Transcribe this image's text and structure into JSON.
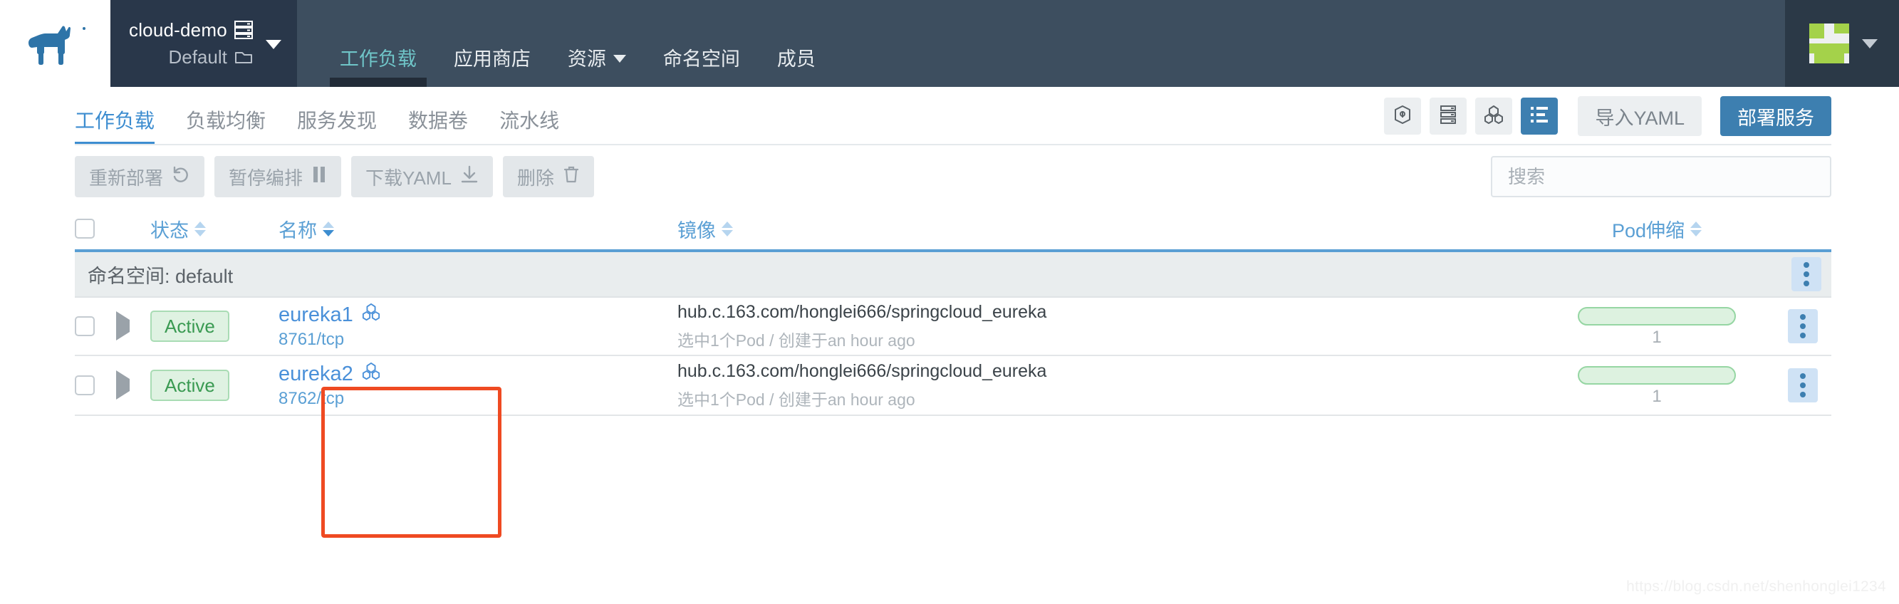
{
  "header": {
    "logo_name": "rancher-bull-logo",
    "project_selector": {
      "cluster": "cloud-demo",
      "cluster_icon": "server-stack-icon",
      "project": "Default",
      "project_icon": "folder-icon",
      "chevron_icon": "chevron-down-icon"
    },
    "nav_items": [
      {
        "label": "工作负载",
        "active": true,
        "has_caret": false
      },
      {
        "label": "应用商店",
        "active": false,
        "has_caret": false
      },
      {
        "label": "资源",
        "active": false,
        "has_caret": true
      },
      {
        "label": "命名空间",
        "active": false,
        "has_caret": false
      },
      {
        "label": "成员",
        "active": false,
        "has_caret": false
      }
    ],
    "user": {
      "avatar_name": "user-avatar-identicon",
      "chevron_icon": "chevron-down-icon"
    }
  },
  "tabs": [
    {
      "label": "工作负载",
      "active": true
    },
    {
      "label": "负载均衡",
      "active": false
    },
    {
      "label": "服务发现",
      "active": false
    },
    {
      "label": "数据卷",
      "active": false
    },
    {
      "label": "流水线",
      "active": false
    }
  ],
  "view_toggles": [
    {
      "icon": "pod-hexagon-icon",
      "selected": false
    },
    {
      "icon": "server-stack-icon",
      "selected": false
    },
    {
      "icon": "workload-cubes-icon",
      "selected": false
    },
    {
      "icon": "list-view-icon",
      "selected": true
    }
  ],
  "actions": {
    "import_yaml": "导入YAML",
    "deploy_service": "部署服务"
  },
  "toolbar": {
    "redeploy": "重新部署",
    "redeploy_icon": "undo-icon",
    "pause_orchestration": "暂停编排",
    "pause_icon": "pause-icon",
    "download_yaml": "下载YAML",
    "download_icon": "download-icon",
    "delete": "删除",
    "delete_icon": "trash-icon"
  },
  "search": {
    "placeholder": "搜索",
    "value": ""
  },
  "table": {
    "columns": [
      {
        "label": "状态",
        "sortable": true,
        "sort_active": false
      },
      {
        "label": "名称",
        "sortable": true,
        "sort_active": true
      },
      {
        "label": "镜像",
        "sortable": true,
        "sort_active": false
      },
      {
        "label": "Pod伸缩",
        "sortable": true,
        "sort_active": false
      }
    ],
    "group": {
      "label": "命名空间: default",
      "menu_icon": "more-vertical-icon"
    },
    "rows": [
      {
        "status": "Active",
        "name": "eureka1",
        "name_icon": "workload-cubes-icon",
        "port": "8761/tcp",
        "image": "hub.c.163.com/honglei666/springcloud_eureka",
        "meta": "选中1个Pod / 创建于an hour ago",
        "scale_count": "1",
        "menu_icon": "more-vertical-icon"
      },
      {
        "status": "Active",
        "name": "eureka2",
        "name_icon": "workload-cubes-icon",
        "port": "8762/tcp",
        "image": "hub.c.163.com/honglei666/springcloud_eureka",
        "meta": "选中1个Pod / 创建于an hour ago",
        "scale_count": "1",
        "menu_icon": "more-vertical-icon"
      }
    ]
  },
  "annotation": {
    "name": "red-highlight-box",
    "color": "#ef4a22"
  },
  "watermark": "https://blog.csdn.net/shenhonglei1234",
  "colors": {
    "header_dark": "#2b3947",
    "nav_mid": "#3d4e5f",
    "nav_active_text": "#6fc5c8",
    "primary_blue": "#3d7fb0",
    "tab_active": "#3d8dd0",
    "status_green": "#3a9a52",
    "annotation_red": "#ef4a22"
  }
}
